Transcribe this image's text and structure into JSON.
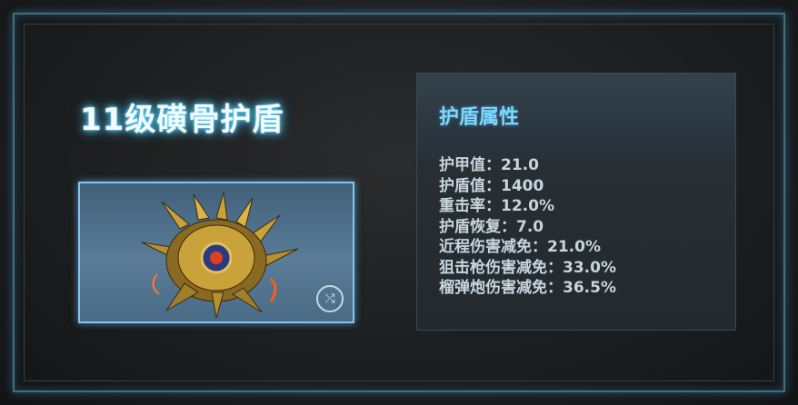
{
  "item": {
    "title": "11级磺骨护盾",
    "swap_icon": "swap-refresh-icon"
  },
  "panel": {
    "title": "护盾属性",
    "stats": [
      "护甲值：21.0",
      "护盾值：1400",
      "重击率：12.0%",
      "护盾恢复：7.0",
      "近程伤害减免：21.0%",
      "狙击枪伤害减免：33.0%",
      "榴弹炮伤害减免：36.5%"
    ]
  },
  "colors": {
    "title_glow": "#4fd2ff",
    "panel_title": "#7cd8ff",
    "stat_text": "#c9d4dc",
    "item_border": "#7fc6f0"
  }
}
